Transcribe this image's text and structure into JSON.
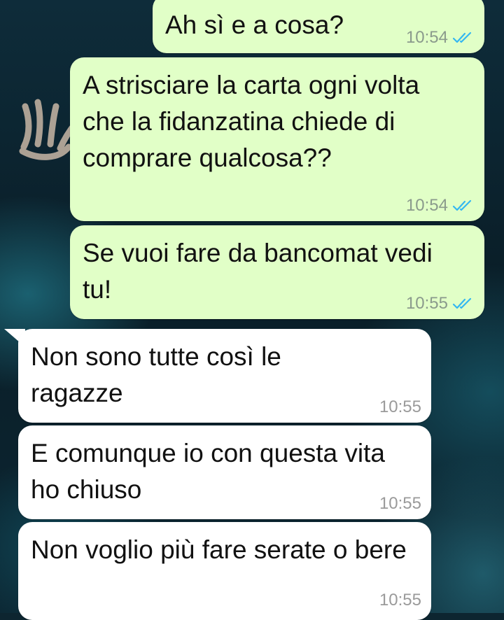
{
  "chat": {
    "messages": [
      {
        "direction": "out",
        "text": "Ah sì e a cosa?",
        "time": "10:54",
        "status_icon": "double-check-read-icon"
      },
      {
        "direction": "out",
        "text": "A strisciare la carta ogni volta che la fidanzatina chiede di comprare qualcosa??",
        "time": "10:54",
        "status_icon": "double-check-read-icon"
      },
      {
        "direction": "out",
        "text": "Se vuoi fare da bancomat vedi tu!",
        "time": "10:55",
        "status_icon": "double-check-read-icon"
      },
      {
        "direction": "in",
        "text": "Non sono tutte così le ragazze",
        "time": "10:55"
      },
      {
        "direction": "in",
        "text": "E comunque io con questa vita ho chiuso",
        "time": "10:55"
      },
      {
        "direction": "in",
        "text": "Non voglio più fare serate o bere",
        "time": "10:55"
      }
    ]
  },
  "colors": {
    "outgoing_bubble": "#e1ffc7",
    "incoming_bubble": "#ffffff",
    "read_tick": "#34b7f1",
    "timestamp": "#8a9a8c"
  }
}
